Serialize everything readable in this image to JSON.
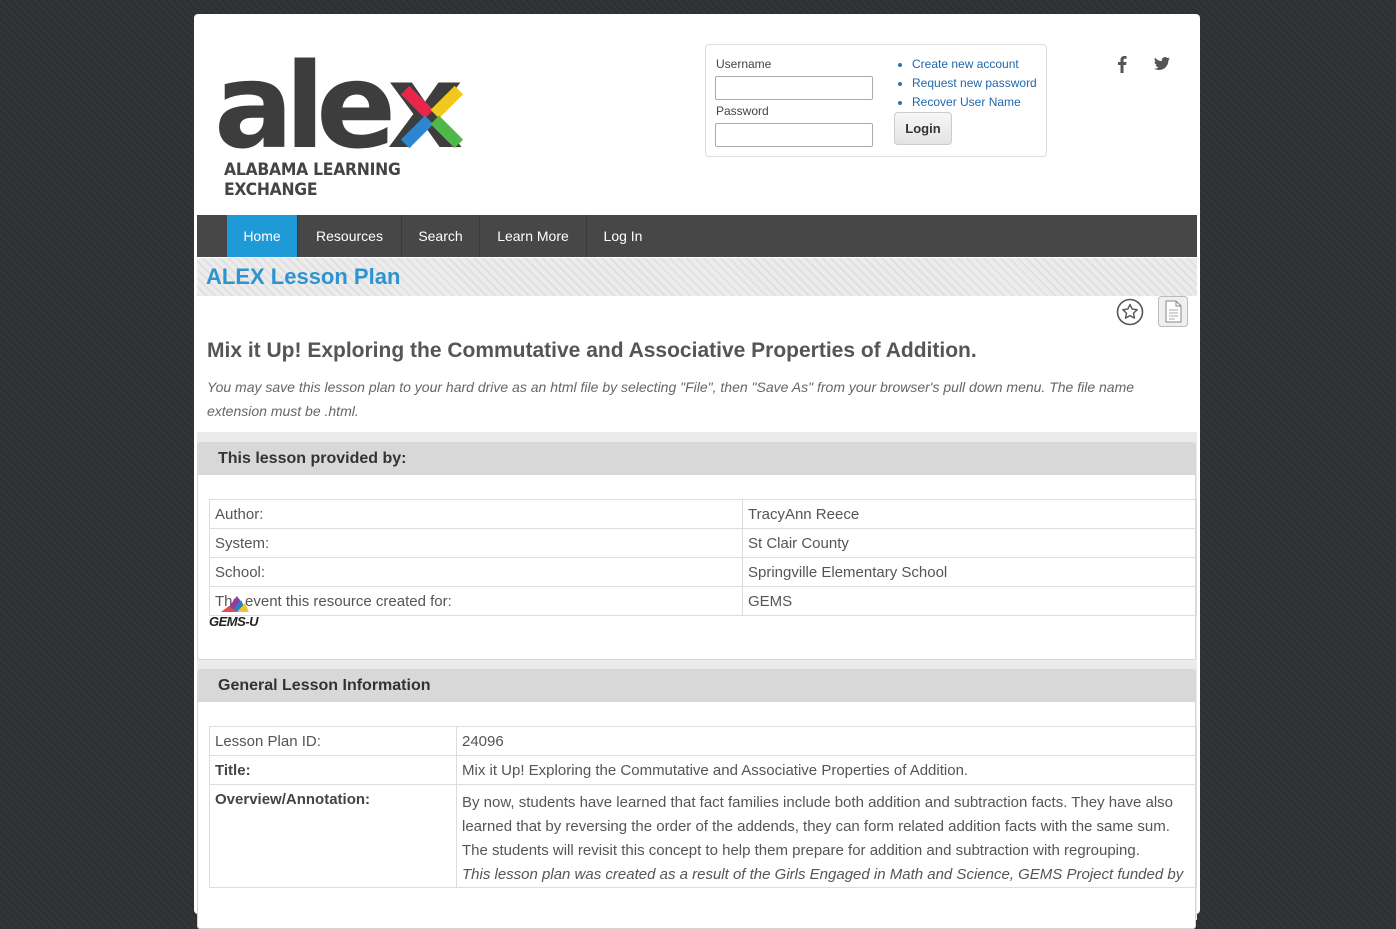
{
  "header": {
    "logo_text": "alex",
    "logo_subtitle": "ALABAMA LEARNING EXCHANGE",
    "logo_colors": [
      "#e8254b",
      "#f2c81f",
      "#2d86cf",
      "#4fb848"
    ]
  },
  "login": {
    "username_label": "Username",
    "password_label": "Password",
    "username_value": "",
    "password_value": "",
    "links": [
      "Create new account",
      "Request new password",
      "Recover User Name"
    ],
    "login_button": "Login"
  },
  "social": [
    "facebook-icon",
    "twitter-icon"
  ],
  "nav": {
    "items": [
      "Home",
      "Resources",
      "Search",
      "Learn More",
      "Log In"
    ],
    "active": "Home",
    "accent": "#1e9bd7"
  },
  "section": {
    "title": "ALEX Lesson Plan"
  },
  "lesson": {
    "title": "Mix it Up! Exploring the Commutative and Associative Properties of Addition.",
    "save_note": "You may save this lesson plan to your hard drive as an html file by selecting \"File\", then \"Save As\" from your browser's pull down menu. The file name extension must be .html."
  },
  "provided_by": {
    "header": "This lesson provided by:",
    "rows": [
      {
        "label": "Author:",
        "value": "TracyAnn Reece"
      },
      {
        "label": "System:",
        "value": "St Clair County"
      },
      {
        "label": "School:",
        "value": "Springville Elementary School"
      },
      {
        "label": "The event this resource created for:",
        "value": "GEMS"
      }
    ],
    "event_logo_text": "GEMS-U"
  },
  "general_info": {
    "header": "General Lesson Information",
    "rows": [
      {
        "label": "Lesson Plan ID:",
        "value": "24096"
      },
      {
        "label": "Title:",
        "value": "Mix it Up! Exploring the Commutative and Associative Properties of Addition."
      },
      {
        "label": "Overview/Annotation:",
        "value": "By now, students have learned that fact families include both addition and subtraction facts. They have also learned that by reversing the order of the addends, they can form related addition facts with the same sum. The students will revisit this concept to help them prepare for addition and subtraction with regrouping.",
        "note": "This lesson plan was created as a result of the Girls Engaged in Math and Science, GEMS Project funded by"
      }
    ]
  }
}
